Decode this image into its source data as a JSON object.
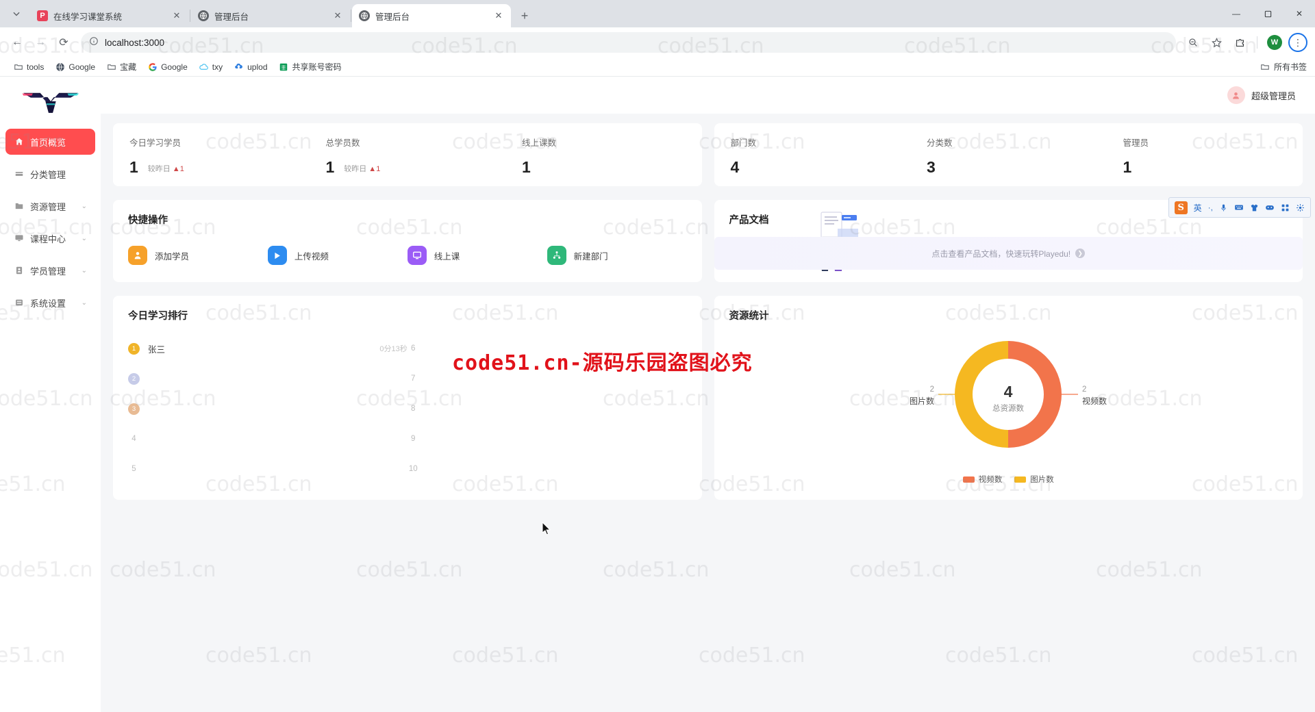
{
  "browser": {
    "tabs": [
      {
        "title": "在线学习课堂系统",
        "favicon": "playedu-icon",
        "active": false,
        "closable": true
      },
      {
        "title": "管理后台",
        "favicon": "globe-icon",
        "active": false,
        "closable": true
      },
      {
        "title": "管理后台",
        "favicon": "globe-icon",
        "active": true,
        "closable": true
      }
    ],
    "new_tab_label": "+",
    "window_controls": {
      "minimize": "—",
      "maximize": "▢",
      "close": "✕"
    },
    "nav": {
      "back": "←",
      "forward": "→",
      "reload": "⟳"
    },
    "omnibox": {
      "url": "localhost:3000",
      "info_icon": "info-icon"
    },
    "toolbar_icons": [
      "zoom-icon",
      "bookmark-star-icon",
      "extensions-icon"
    ],
    "profile_initial": "W",
    "menu_icon": "⋮",
    "bookmarks": [
      {
        "label": "tools",
        "icon": "folder-icon"
      },
      {
        "label": "Google",
        "icon": "globe-icon"
      },
      {
        "label": "宝藏",
        "icon": "folder-icon"
      },
      {
        "label": "Google",
        "icon": "google-g-icon"
      },
      {
        "label": "txy",
        "icon": "cloud-icon"
      },
      {
        "label": "uplod",
        "icon": "upload-cloud-icon"
      },
      {
        "label": "共享账号密码",
        "icon": "sheet-icon"
      }
    ],
    "bookmarks_right": {
      "label": "所有书签",
      "icon": "folder-icon"
    }
  },
  "sidebar": {
    "logo_alt": "playedu-logo",
    "items": [
      {
        "label": "首页概览",
        "icon": "home-icon",
        "active": true,
        "caret": ""
      },
      {
        "label": "分类管理",
        "icon": "tag-icon",
        "active": false,
        "caret": ""
      },
      {
        "label": "资源管理",
        "icon": "folder-icon",
        "active": false,
        "caret": "⌄"
      },
      {
        "label": "课程中心",
        "icon": "monitor-icon",
        "active": false,
        "caret": "⌄"
      },
      {
        "label": "学员管理",
        "icon": "user-icon",
        "active": false,
        "caret": "⌄"
      },
      {
        "label": "系统设置",
        "icon": "settings-icon",
        "active": false,
        "caret": "⌄"
      }
    ]
  },
  "topbar": {
    "user_name": "超级管理员",
    "avatar_icon": "user-avatar-icon"
  },
  "stats": [
    {
      "title": "今日学习学员",
      "value": "1",
      "delta_label": "较昨日",
      "delta_value": "1",
      "delta_dir": "▲"
    },
    {
      "title": "总学员数",
      "value": "1",
      "delta_label": "较昨日",
      "delta_value": "1",
      "delta_dir": "▲"
    },
    {
      "title": "线上课数",
      "value": "1",
      "delta_label": "",
      "delta_value": "",
      "delta_dir": ""
    },
    {
      "title": "部门数",
      "value": "4",
      "delta_label": "",
      "delta_value": "",
      "delta_dir": ""
    },
    {
      "title": "分类数",
      "value": "3",
      "delta_label": "",
      "delta_value": "",
      "delta_dir": ""
    },
    {
      "title": "管理员",
      "value": "1",
      "delta_label": "",
      "delta_value": "",
      "delta_dir": ""
    }
  ],
  "quick": {
    "title": "快捷操作",
    "actions": [
      {
        "label": "添加学员",
        "icon": "add-user-icon",
        "color": "#f6a12a"
      },
      {
        "label": "上传视频",
        "icon": "play-icon",
        "color": "#2d8cf0"
      },
      {
        "label": "线上课",
        "icon": "live-class-icon",
        "color": "#9b5cf6"
      },
      {
        "label": "新建部门",
        "icon": "org-tree-icon",
        "color": "#2fb87a"
      }
    ]
  },
  "doc": {
    "title": "产品文档",
    "banner_text": "点击查看产品文档，快速玩转Playedu!",
    "arrow_icon": "chevron-right-icon"
  },
  "rank": {
    "title": "今日学习排行",
    "left": [
      {
        "rank": "1",
        "name": "张三",
        "time": "0分13秒",
        "badge": "gold"
      },
      {
        "rank": "2",
        "name": "",
        "time": "",
        "badge": "silver"
      },
      {
        "rank": "3",
        "name": "",
        "time": "",
        "badge": "bronze"
      },
      {
        "rank": "4",
        "name": "",
        "time": "",
        "badge": ""
      },
      {
        "rank": "5",
        "name": "",
        "time": "",
        "badge": ""
      }
    ],
    "right": [
      {
        "rank": "6",
        "name": "",
        "time": "",
        "badge": ""
      },
      {
        "rank": "7",
        "name": "",
        "time": "",
        "badge": ""
      },
      {
        "rank": "8",
        "name": "",
        "time": "",
        "badge": ""
      },
      {
        "rank": "9",
        "name": "",
        "time": "",
        "badge": ""
      },
      {
        "rank": "10",
        "name": "",
        "time": "",
        "badge": ""
      }
    ]
  },
  "resource_chart": {
    "title": "资源统计",
    "center_value": "4",
    "center_label": "总资源数",
    "left_value": "2",
    "left_label": "图片数",
    "right_value": "2",
    "right_label": "视频数",
    "legend": [
      {
        "label": "视频数",
        "color": "#f2744b"
      },
      {
        "label": "图片数",
        "color": "#f5b821"
      }
    ]
  },
  "chart_data": {
    "type": "pie",
    "title": "资源统计",
    "categories": [
      "视频数",
      "图片数"
    ],
    "values": [
      2,
      2
    ],
    "colors": [
      "#f2744b",
      "#f5b821"
    ],
    "total": 4,
    "center_label": "总资源数",
    "legend_position": "bottom",
    "donut": true
  },
  "ime": {
    "logo": "S",
    "items": [
      "英",
      "·,",
      "mic-icon",
      "keyboard-icon",
      "skin-icon",
      "emoji-icon",
      "apps-icon",
      "tools-icon"
    ]
  },
  "watermark": {
    "tile_text": "code51.cn",
    "banner_text": "code51.cn-源码乐园盗图必究"
  }
}
